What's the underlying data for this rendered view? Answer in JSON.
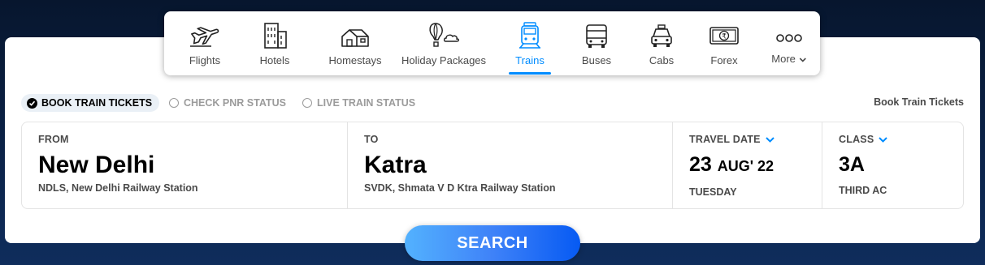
{
  "nav": {
    "items": [
      {
        "label": "Flights",
        "icon": "plane-icon"
      },
      {
        "label": "Hotels",
        "icon": "building-icon"
      },
      {
        "label": "Homestays",
        "icon": "house-icon"
      },
      {
        "label": "Holiday Packages",
        "icon": "balloon-icon"
      },
      {
        "label": "Trains",
        "icon": "train-icon",
        "active": true
      },
      {
        "label": "Buses",
        "icon": "bus-icon"
      },
      {
        "label": "Cabs",
        "icon": "cab-icon"
      },
      {
        "label": "Forex",
        "icon": "rupee-note-icon"
      },
      {
        "label": "More",
        "icon": "more-dots-icon"
      }
    ]
  },
  "tabs": {
    "book": "BOOK TRAIN TICKETS",
    "pnr": "CHECK PNR STATUS",
    "live": "LIVE TRAIN STATUS"
  },
  "side_title": "Book Train Tickets",
  "form": {
    "from": {
      "caption": "FROM",
      "city": "New Delhi",
      "station": "NDLS, New Delhi Railway Station"
    },
    "to": {
      "caption": "TO",
      "city": "Katra",
      "station": "SVDK, Shmata V D Ktra Railway Station"
    },
    "date": {
      "caption": "TRAVEL DATE",
      "day": "23",
      "month_year": "AUG' 22",
      "weekday": "TUESDAY"
    },
    "class": {
      "caption": "CLASS",
      "code": "3A",
      "name": "THIRD AC"
    }
  },
  "search": {
    "label": "SEARCH"
  },
  "colors": {
    "accent": "#008cff",
    "active_tab_bg": "#eaf0f6",
    "button_start": "#53b2fe",
    "button_end": "#065af3"
  }
}
